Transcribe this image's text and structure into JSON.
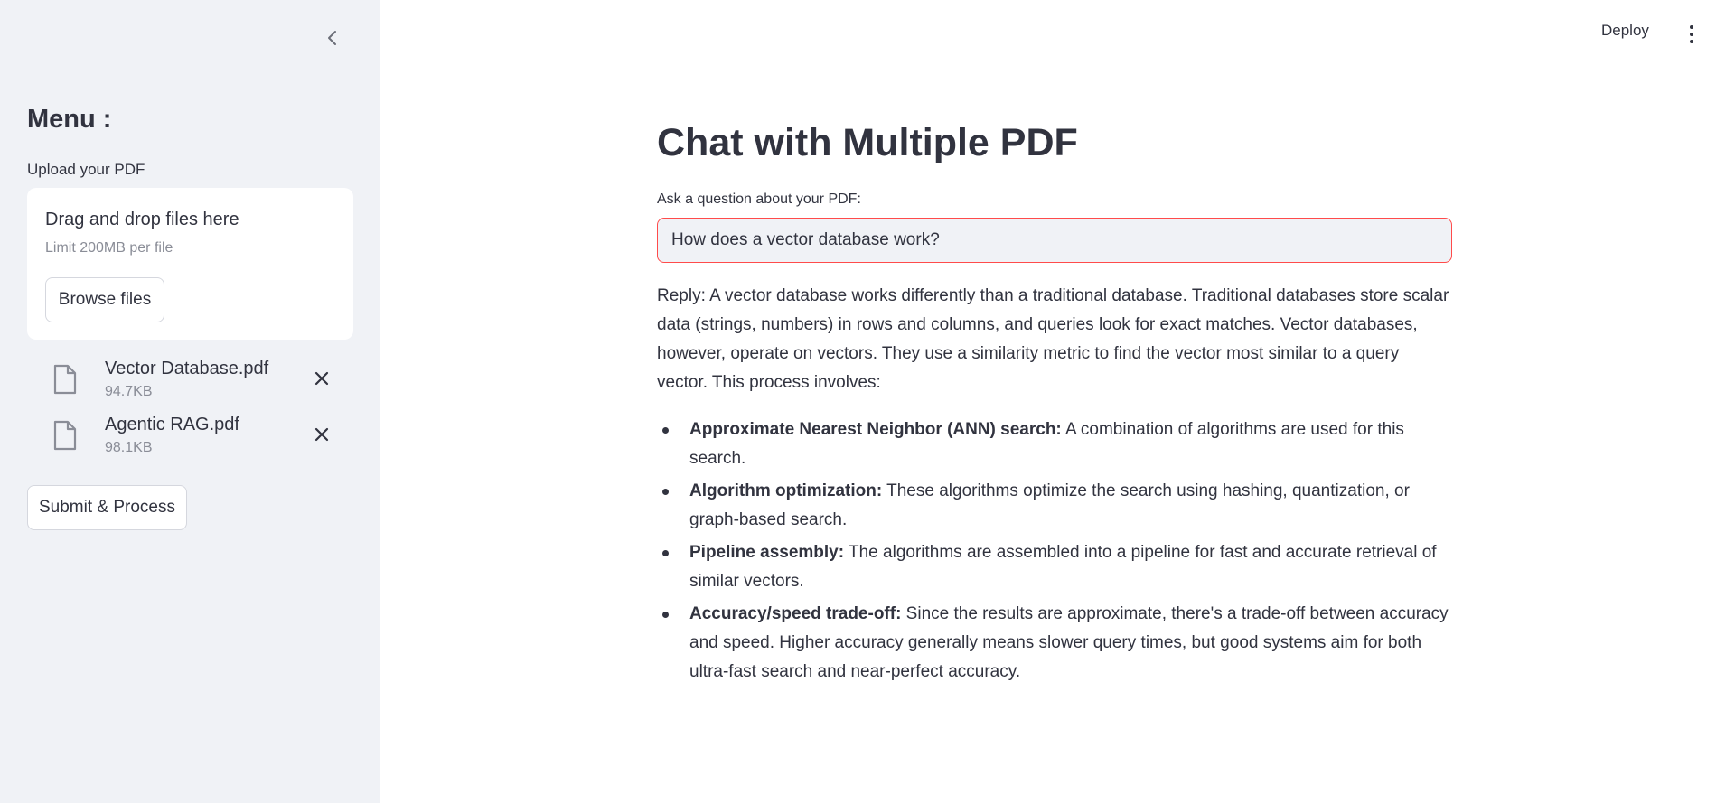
{
  "sidebar": {
    "menu_title": "Menu :",
    "upload_label": "Upload your PDF",
    "dropzone": {
      "title": "Drag and drop files here",
      "limit": "Limit 200MB per file",
      "browse_label": "Browse files"
    },
    "files": [
      {
        "name": "Vector Database.pdf",
        "size": "94.7KB"
      },
      {
        "name": "Agentic RAG.pdf",
        "size": "98.1KB"
      }
    ],
    "submit_label": "Submit & Process"
  },
  "header": {
    "deploy_label": "Deploy"
  },
  "main": {
    "title": "Chat with Multiple PDF",
    "question_label": "Ask a question about your PDF:",
    "question_value": "How does a vector database work?",
    "reply": "Reply: A vector database works differently than a traditional database. Traditional databases store scalar data (strings, numbers) in rows and columns, and queries look for exact matches. Vector databases, however, operate on vectors. They use a similarity metric to find the vector most similar to a query vector. This process involves:",
    "bullets": [
      {
        "term": "Approximate Nearest Neighbor (ANN) search:",
        "text": " A combination of algorithms are used for this search."
      },
      {
        "term": "Algorithm optimization:",
        "text": " These algorithms optimize the search using hashing, quantization, or graph-based search."
      },
      {
        "term": "Pipeline assembly:",
        "text": " The algorithms are assembled into a pipeline for fast and accurate retrieval of similar vectors."
      },
      {
        "term": "Accuracy/speed trade-off:",
        "text": " Since the results are approximate, there's a trade-off between accuracy and speed. Higher accuracy generally means slower query times, but good systems aim for both ultra-fast search and near-perfect accuracy."
      }
    ]
  },
  "colors": {
    "sidebar_bg": "#f0f2f6",
    "text": "#31333f",
    "input_border_focus": "#ff4b4b",
    "muted": "#8a8d97"
  },
  "icons": {
    "collapse": "chevron-left-icon",
    "file": "file-icon",
    "remove": "close-icon",
    "menu": "kebab-menu-icon"
  }
}
